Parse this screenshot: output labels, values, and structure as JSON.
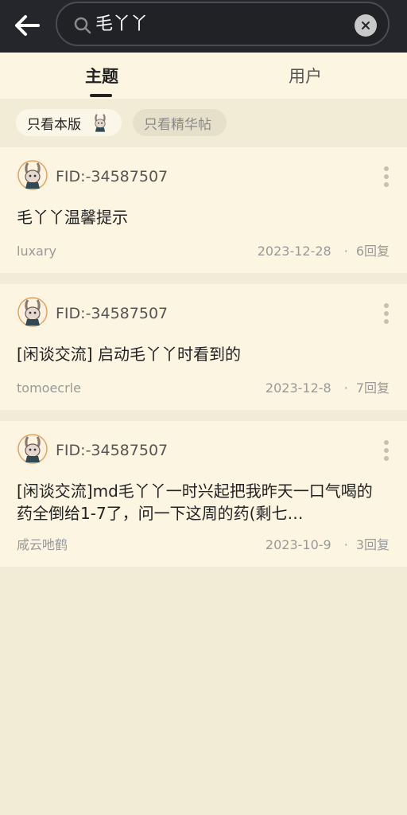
{
  "header": {
    "back_icon": "arrow-left-icon",
    "search_icon": "search-icon",
    "search_value": "毛丫丫",
    "clear_icon": "close-circle-icon"
  },
  "tabs": [
    {
      "label": "主题",
      "active": true
    },
    {
      "label": "用户",
      "active": false
    }
  ],
  "filters": {
    "only_this_board": "只看本版",
    "only_featured": "只看精华帖"
  },
  "posts": [
    {
      "fid": "FID:-34587507",
      "title": "毛丫丫温馨提示",
      "author": "luxary",
      "date": "2023-12-28",
      "replies": "6回复"
    },
    {
      "fid": "FID:-34587507",
      "title": "[闲谈交流] 启动毛丫丫时看到的",
      "author": "tomoecrle",
      "date": "2023-12-8",
      "replies": "7回复"
    },
    {
      "fid": "FID:-34587507",
      "title": "[闲谈交流]md毛丫丫一时兴起把我昨天一口气喝的药全倒给1-7了，问一下这周的药(剩七…",
      "author": "咸云吔鹤",
      "date": "2023-10-9",
      "replies": "3回复"
    }
  ],
  "colors": {
    "header_bg": "#24262b",
    "page_bg": "#f2ecd7",
    "card_bg": "#fbf5e2"
  }
}
